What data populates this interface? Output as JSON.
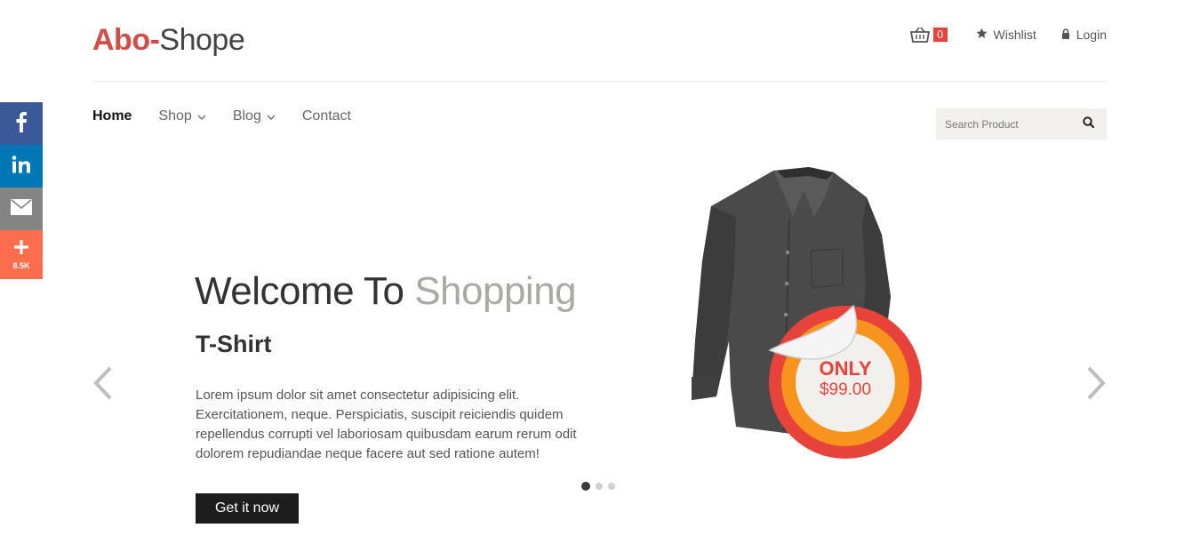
{
  "header": {
    "logo_brand": "Abo-",
    "logo_rest": "Shope",
    "cart_count": "0",
    "wishlist_label": "Wishlist",
    "login_label": "Login"
  },
  "nav": {
    "items": [
      {
        "label": "Home",
        "active": true
      },
      {
        "label": "Shop",
        "dropdown": true
      },
      {
        "label": "Blog",
        "dropdown": true
      },
      {
        "label": "Contact"
      }
    ]
  },
  "search": {
    "placeholder": "Search Product"
  },
  "social": {
    "share_count": "8.5K"
  },
  "hero": {
    "title_main": "Welcome To ",
    "title_light": "Shopping",
    "subtitle": "T-Shirt",
    "body": "Lorem ipsum dolor sit amet consectetur adipisicing elit. Exercitationem, neque. Perspiciatis, suscipit reiciendis quidem repellendus corrupti vel laboriosam quibusdam earum rerum odit dolorem repudiandae neque facere aut sed ratione autem!",
    "cta_label": "Get it now",
    "badge_only": "ONLY",
    "badge_price": "$99.00"
  },
  "carousel": {
    "slide_count": 3,
    "active_slide": 1
  },
  "colors": {
    "brand_red": "#d24b47",
    "badge_orange": "#f7941d",
    "facebook": "#3b5998",
    "linkedin": "#0077b5",
    "mail": "#848484",
    "share": "#fc6d4c"
  }
}
